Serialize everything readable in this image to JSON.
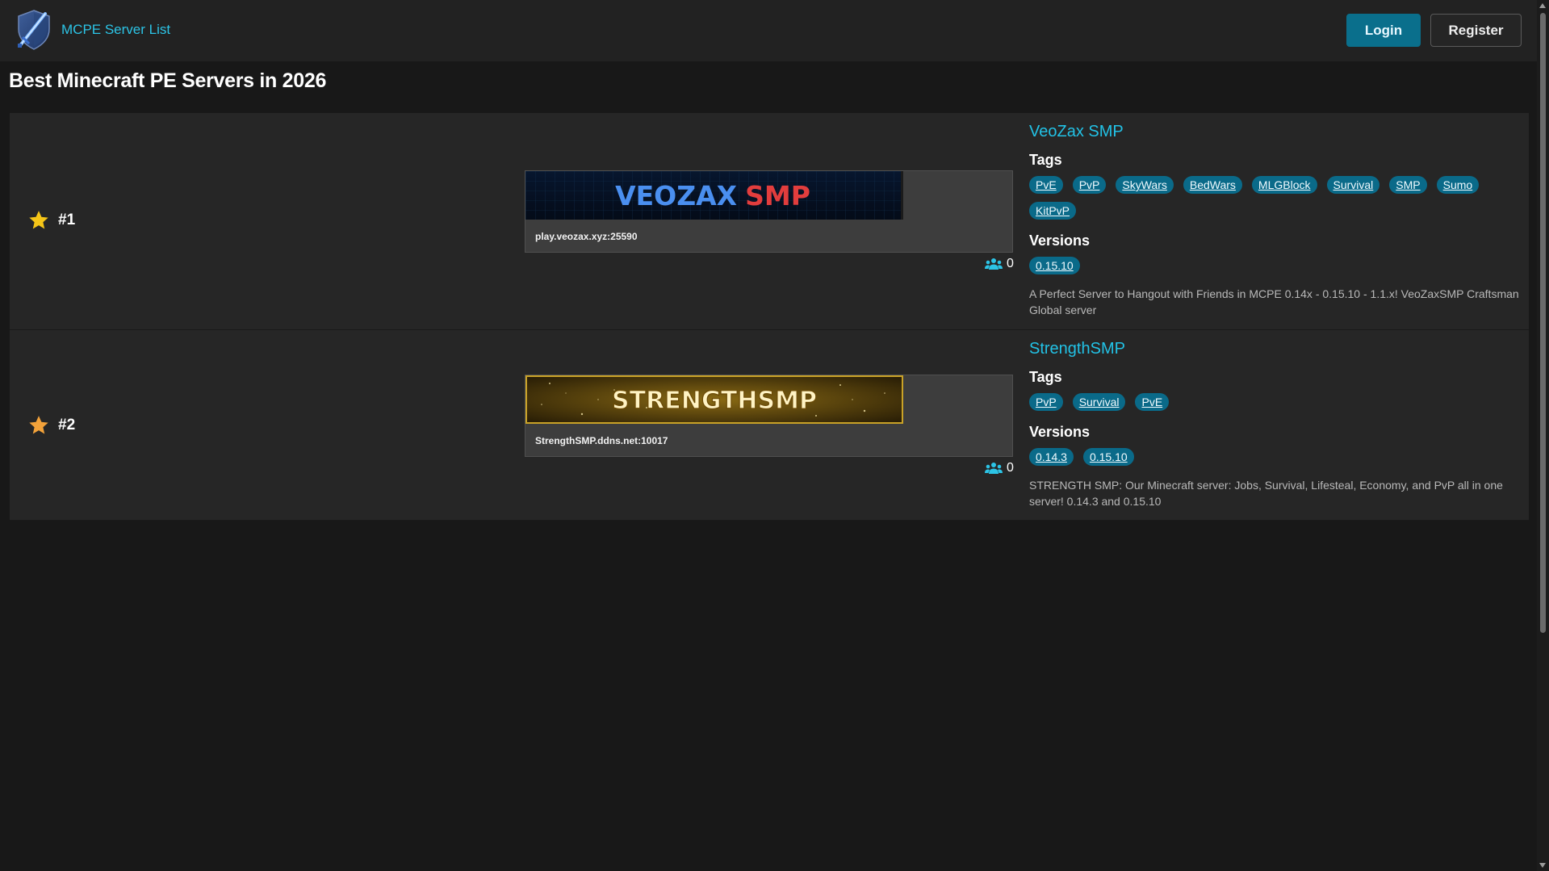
{
  "header": {
    "site_name": "MCPE Server List",
    "login_label": "Login",
    "register_label": "Register"
  },
  "page": {
    "title": "Best Minecraft PE Servers in 2026"
  },
  "servers": [
    {
      "rank": "#1",
      "name": "VeoZax SMP",
      "banner_text_1": "VEOZAX",
      "banner_text_2": "SMP",
      "address": "play.veozax.xyz:25590",
      "players": "0",
      "tags_heading": "Tags",
      "tags": [
        "PvE",
        "PvP",
        "SkyWars",
        "BedWars",
        "MLGBlock",
        "Survival",
        "SMP",
        "Sumo",
        "KitPvP"
      ],
      "versions_heading": "Versions",
      "versions": [
        "0.15.10"
      ],
      "description": "A Perfect Server to Hangout with Friends in MCPE 0.14x - 0.15.10 - 1.1.x! VeoZaxSMP Craftsman Global server"
    },
    {
      "rank": "#2",
      "name": "StrengthSMP",
      "banner_text_1": "STRENGTHSMP",
      "address": "StrengthSMP.ddns.net:10017",
      "players": "0",
      "tags_heading": "Tags",
      "tags": [
        "PvP",
        "Survival",
        "PvE"
      ],
      "versions_heading": "Versions",
      "versions": [
        "0.14.3",
        "0.15.10"
      ],
      "description": "STRENGTH SMP: Our Minecraft server: Jobs, Survival, Lifesteal, Economy, and PvP all in one server! 0.14.3 and 0.15.10"
    }
  ],
  "colors": {
    "accent": "#22c2e6",
    "pill": "#0a6a89",
    "star_gold": "#f5c518",
    "star_orange": "#f2a23a"
  }
}
